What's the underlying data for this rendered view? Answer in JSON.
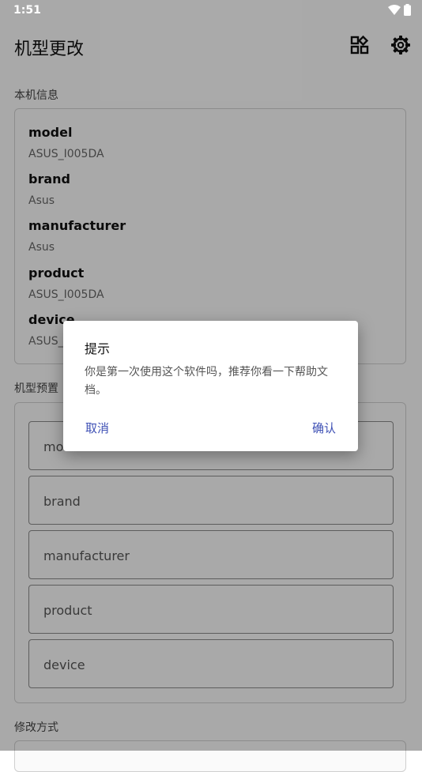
{
  "status_bar": {
    "time": "1:51"
  },
  "header": {
    "title": "机型更改"
  },
  "device_info": {
    "section_title": "本机信息",
    "items": [
      {
        "key": "model",
        "value": "ASUS_I005DA"
      },
      {
        "key": "brand",
        "value": "Asus"
      },
      {
        "key": "manufacturer",
        "value": "Asus"
      },
      {
        "key": "product",
        "value": "ASUS_I005DA"
      },
      {
        "key": "device",
        "value": "ASUS_I005DA"
      }
    ]
  },
  "preset": {
    "section_title": "机型预置",
    "fields": [
      {
        "placeholder": "model"
      },
      {
        "placeholder": "brand"
      },
      {
        "placeholder": "manufacturer"
      },
      {
        "placeholder": "product"
      },
      {
        "placeholder": "device"
      }
    ]
  },
  "modify": {
    "section_title": "修改方式"
  },
  "dialog": {
    "title": "提示",
    "message": "你是第一次使用这个软件吗，推荐你看一下帮助文档。",
    "cancel": "取消",
    "confirm": "确认"
  },
  "colors": {
    "accent": "#3f51b5",
    "scrim": "rgba(0,0,0,0.32)"
  },
  "icons": {
    "wifi": "wifi-icon",
    "battery": "battery-icon",
    "apps": "apps-icon",
    "settings": "gear-icon"
  }
}
